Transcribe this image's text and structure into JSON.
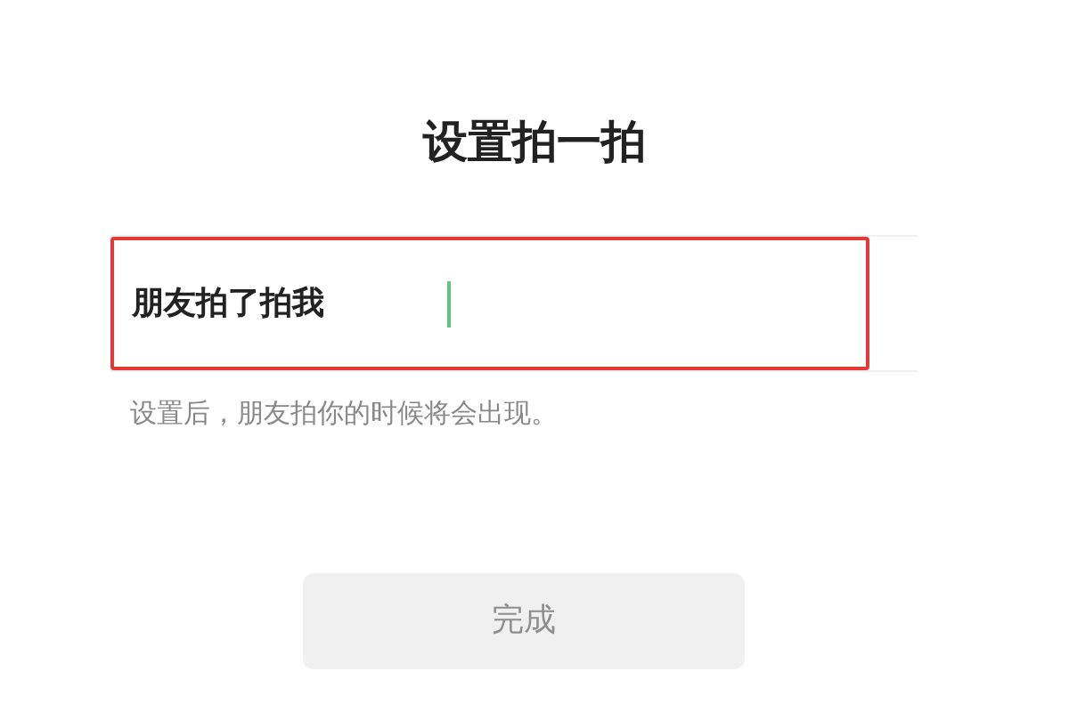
{
  "title": "设置拍一拍",
  "field": {
    "label": "朋友拍了拍我",
    "focused": true,
    "highlighted": true
  },
  "hint": "设置后，朋友拍你的时候将会出现。",
  "button": {
    "label": "完成",
    "disabled": true
  }
}
